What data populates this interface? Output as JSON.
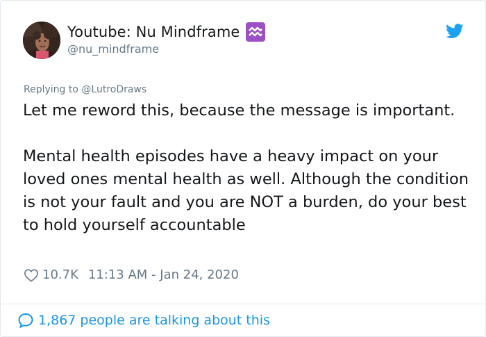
{
  "author": {
    "display_name": "Youtube: Nu Mindframe",
    "handle": "@nu_mindframe",
    "badge_icon": "aquarius-icon"
  },
  "reply": {
    "prefix": "Replying to ",
    "mention": "@LutroDraws"
  },
  "tweet": {
    "paragraph1": "Let me reword this, because the message is important.",
    "paragraph2": "Mental health episodes have a heavy impact on your loved ones mental health as well. Although the condition is not your fault and you are NOT a burden, do your best to hold yourself accountable"
  },
  "meta": {
    "likes": "10.7K",
    "timestamp": "11:13 AM - Jan 24, 2020"
  },
  "footer": {
    "talking": "1,867 people are talking about this"
  },
  "colors": {
    "accent": "#1b95e0",
    "twitter_blue": "#1da1f2",
    "muted": "#657786",
    "badge_purple": "#9b51c4"
  }
}
